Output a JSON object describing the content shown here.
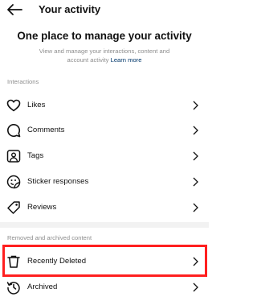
{
  "header": {
    "title": "Your activity",
    "back_icon": "back-arrow-icon"
  },
  "intro": {
    "headline": "One place to manage your activity",
    "description": "View and manage your interactions, content and account activity",
    "learn_more": "Learn more"
  },
  "sections": {
    "interactions_label": "Interactions",
    "removed_label": "Removed and archived content"
  },
  "items": [
    {
      "label": "Likes",
      "icon": "heart-icon"
    },
    {
      "label": "Comments",
      "icon": "comment-bubble-icon"
    },
    {
      "label": "Tags",
      "icon": "tag-person-icon"
    },
    {
      "label": "Sticker responses",
      "icon": "sticker-icon"
    },
    {
      "label": "Reviews",
      "icon": "review-tag-icon"
    },
    {
      "label": "Recently Deleted",
      "icon": "trash-icon"
    },
    {
      "label": "Archived",
      "icon": "archive-history-icon"
    }
  ],
  "colors": {
    "highlight": "#ff1f1f",
    "link": "#00376b",
    "muted": "#8e8e8e"
  }
}
